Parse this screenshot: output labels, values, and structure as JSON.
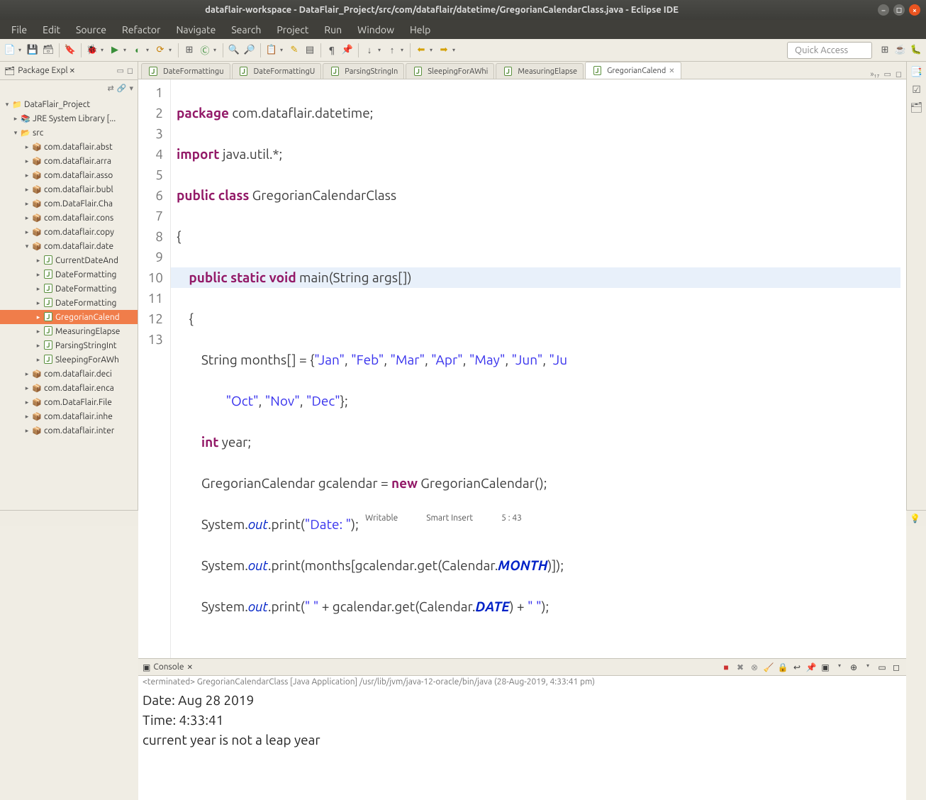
{
  "window": {
    "title": "dataflair-workspace - DataFlair_Project/src/com/dataflair/datetime/GregorianCalendarClass.java - Eclipse IDE"
  },
  "menu": [
    "File",
    "Edit",
    "Source",
    "Refactor",
    "Navigate",
    "Search",
    "Project",
    "Run",
    "Window",
    "Help"
  ],
  "quick_access_placeholder": "Quick Access",
  "package_explorer": {
    "title": "Package Expl",
    "project": "DataFlair_Project",
    "jre": "JRE System Library [...",
    "src": "src",
    "packages": [
      "com.dataflair.abst",
      "com.dataflair.arra",
      "com.dataflair.asso",
      "com.dataflair.bubl",
      "com.DataFlair.Cha",
      "com.dataflair.cons",
      "com.dataflair.copy",
      "com.dataflair.date"
    ],
    "date_files": [
      "CurrentDateAnd",
      "DateFormatting",
      "DateFormatting",
      "DateFormatting",
      "GregorianCalend",
      "MeasuringElapse",
      "ParsingStringInt",
      "SleepingForAWh"
    ],
    "more_packages": [
      "com.dataflair.deci",
      "com.dataflair.enca",
      "com.DataFlair.File",
      "com.dataflair.inhe",
      "com.dataflair.inter"
    ]
  },
  "editor_tabs": [
    "DateFormattingu",
    "DateFormattingU",
    "ParsingStringIn",
    "SleepingForAWhi",
    "MeasuringElapse",
    "GregorianCalend"
  ],
  "editor_more": "»₁₇",
  "code": {
    "l1a": "package",
    "l1b": " com.dataflair.datetime;",
    "l2a": "import",
    "l2b": " java.util.*;",
    "l3a": "public",
    "l3b": " class",
    "l3c": " GregorianCalendarClass",
    "l4": "{",
    "l5a": "public",
    "l5b": " static",
    "l5c": " void",
    "l5d": " main(String args[])",
    "l6": "{",
    "l7a": "String months[] = {",
    "l7b": "\"Jan\"",
    "l7c": ", ",
    "l7d": "\"Feb\"",
    "l7e": ", ",
    "l7f": "\"Mar\"",
    "l7g": ", ",
    "l7h": "\"Apr\"",
    "l7i": ", ",
    "l7j": "\"May\"",
    "l7k": ", ",
    "l7l": "\"Jun\"",
    "l7m": ", ",
    "l7n": "\"Ju",
    "l8a": "\"Oct\"",
    "l8b": ", ",
    "l8c": "\"Nov\"",
    "l8d": ", ",
    "l8e": "\"Dec\"",
    "l8f": "};",
    "l9a": "int",
    "l9b": " year;",
    "l10a": "GregorianCalendar gcalendar = ",
    "l10b": "new",
    "l10c": " GregorianCalendar();",
    "l11a": "System.",
    "l11b": "out",
    "l11c": ".print(",
    "l11d": "\"Date: \"",
    "l11e": ");",
    "l12a": "System.",
    "l12b": "out",
    "l12c": ".print(months[gcalendar.get(Calendar.",
    "l12d": "MONTH",
    "l12e": ")]);",
    "l13a": "System.",
    "l13b": "out",
    "l13c": ".print(",
    "l13d": "\" \"",
    "l13e": " + gcalendar.get(Calendar.",
    "l13f": "DATE",
    "l13g": ") + ",
    "l13h": "\" \"",
    "l13i": ");"
  },
  "line_numbers": [
    "1",
    "2",
    "3",
    "4",
    "5",
    "6",
    "7",
    "8",
    "9",
    "10",
    "11",
    "12",
    "13"
  ],
  "console": {
    "title": "Console",
    "status": "<terminated> GregorianCalendarClass [Java Application] /usr/lib/jvm/java-12-oracle/bin/java (28-Aug-2019, 4:33:41 pm)",
    "out1": "Date: Aug 28 2019",
    "out2": "Time: 4:33:41",
    "out3": "current year is not a leap year"
  },
  "status": {
    "writable": "Writable",
    "insert": "Smart Insert",
    "pos": "5 : 43"
  }
}
